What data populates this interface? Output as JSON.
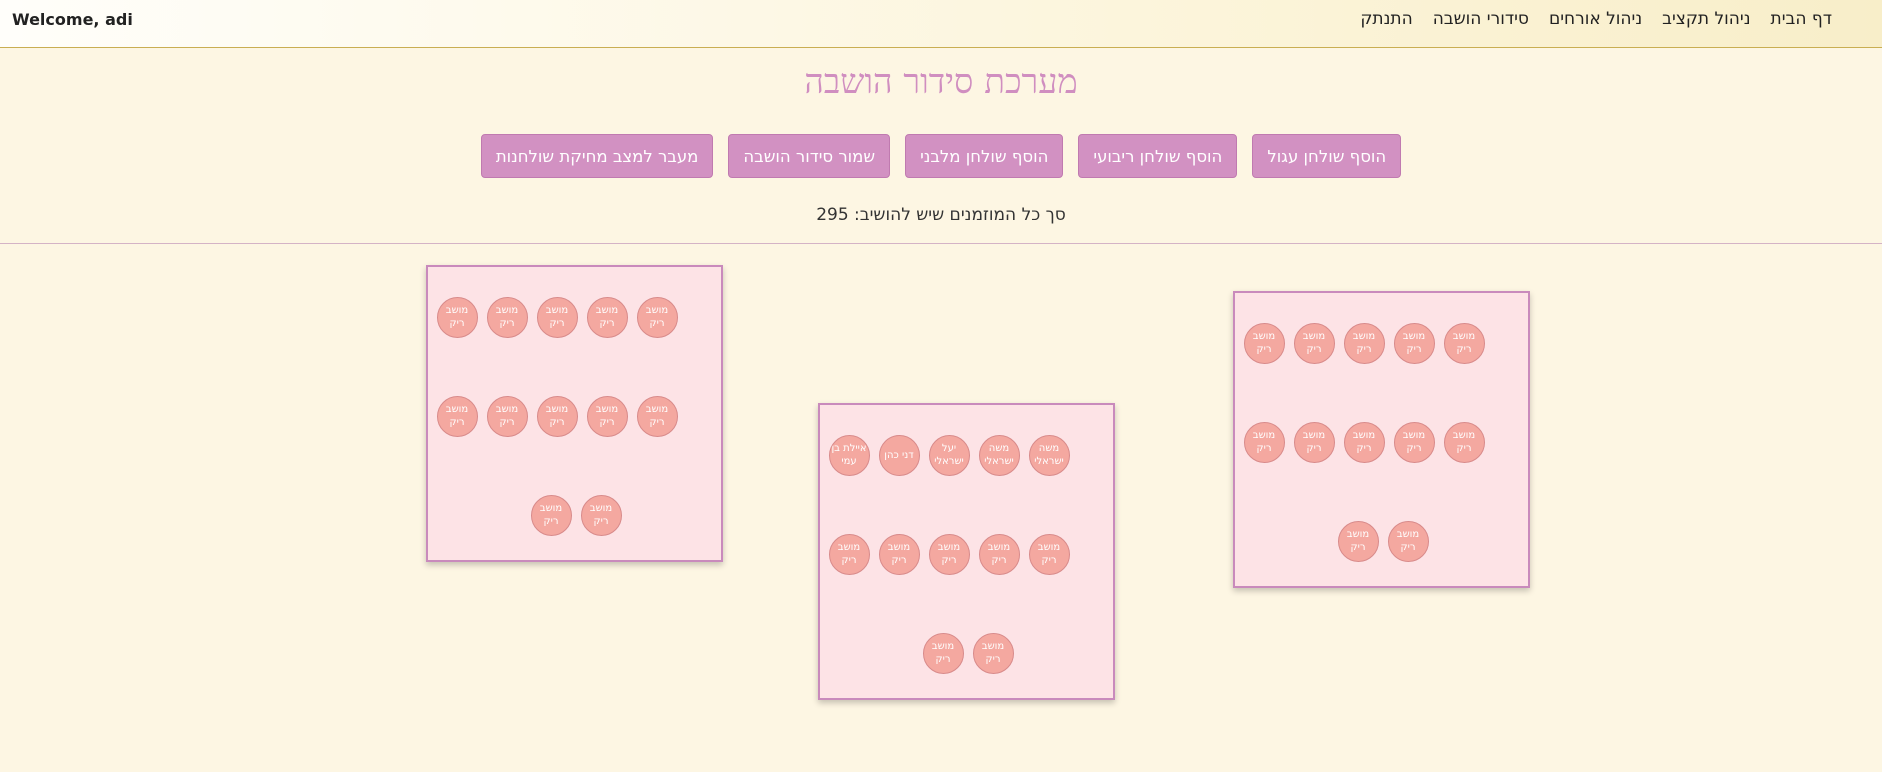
{
  "navbar": {
    "welcome": "Welcome, adi",
    "links": [
      "דף הבית",
      "ניהול תקציב",
      "ניהול אורחים",
      "סידורי הושבה",
      "התנתק"
    ]
  },
  "page_title": "מערכת סידור הושבה",
  "toolbar": {
    "buttons": [
      "הוסף שולחן עגול",
      "הוסף שולחן ריבועי",
      "הוסף שולחן מלבני",
      "שמור סידור הושבה",
      "מעבר למצב מחיקת שולחנות"
    ]
  },
  "total_guests_text": "סך כל המוזמנים שיש להושיב: 295",
  "tables": [
    {
      "seats": [
        "מושב ריק",
        "מושב ריק",
        "מושב ריק",
        "מושב ריק",
        "מושב ריק",
        "מושב ריק",
        "מושב ריק",
        "מושב ריק",
        "מושב ריק",
        "מושב ריק",
        "מושב ריק",
        "מושב ריק"
      ]
    },
    {
      "seats": [
        "משה ישראלי",
        "משה ישראלי",
        "יעל ישראלי",
        "דני כהן",
        "איילת בן עמי",
        "מושב ריק",
        "מושב ריק",
        "מושב ריק",
        "מושב ריק",
        "מושב ריק",
        "מושב ריק",
        "מושב ריק"
      ]
    },
    {
      "seats": [
        "מושב ריק",
        "מושב ריק",
        "מושב ריק",
        "מושב ריק",
        "מושב ריק",
        "מושב ריק",
        "מושב ריק",
        "מושב ריק",
        "מושב ריק",
        "מושב ריק",
        "מושב ריק",
        "מושב ריק"
      ]
    }
  ],
  "colors": {
    "accent": "#d291c2",
    "title": "#d08ec0",
    "background": "#fdf6e3",
    "table_fill": "#fde3e6",
    "seat_fill": "#f4a8a0"
  }
}
